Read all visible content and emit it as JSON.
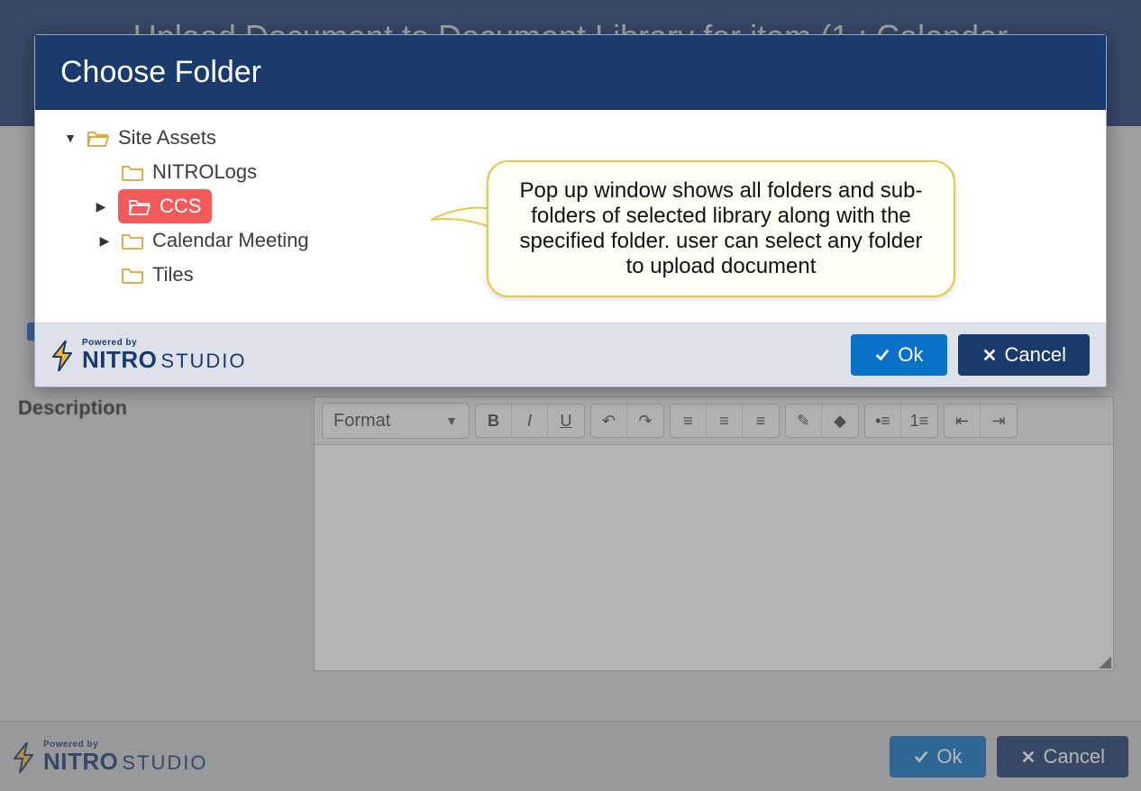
{
  "colors": {
    "primary": "#0a72c7",
    "header": "#1a3a6e",
    "selected": "#f15b5b",
    "folderStroke": "#d9a43a"
  },
  "background": {
    "headerTitle": "Upload Document to Document Library for item (1 : Calendar",
    "descriptionLabel": "Description",
    "toolbar": {
      "formatLabel": "Format"
    },
    "footer": {
      "ok": "Ok",
      "cancel": "Cancel"
    }
  },
  "brand": {
    "powered": "Powered by",
    "nitro": "NITRO",
    "studio": "STUDIO"
  },
  "modal": {
    "title": "Choose Folder",
    "tree": {
      "root": "Site Assets",
      "children": [
        {
          "label": "NITROLogs",
          "hasChildren": false,
          "selected": false
        },
        {
          "label": "CCS",
          "hasChildren": true,
          "selected": true
        },
        {
          "label": "Calendar Meeting",
          "hasChildren": true,
          "selected": false
        },
        {
          "label": "Tiles",
          "hasChildren": false,
          "selected": false
        }
      ]
    },
    "ok": "Ok",
    "cancel": "Cancel"
  },
  "annotation": {
    "text": "Pop up window shows all folders and sub-folders of selected library along with the specified folder. user can select any folder to upload document"
  }
}
